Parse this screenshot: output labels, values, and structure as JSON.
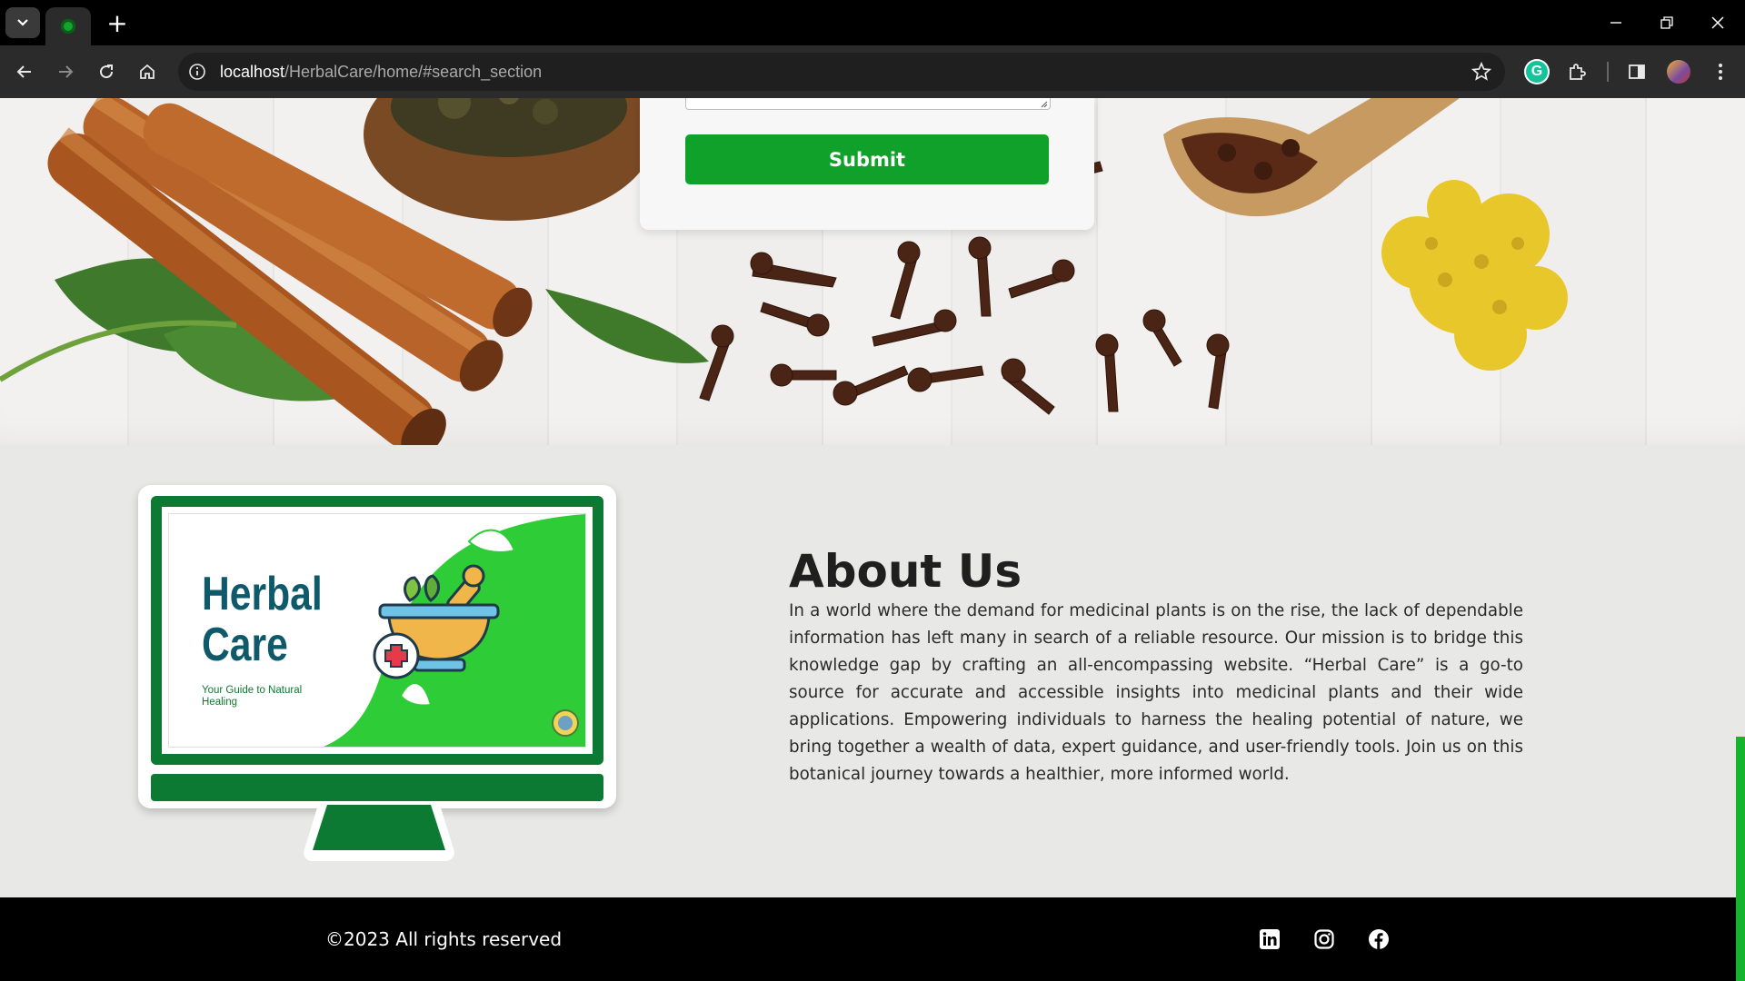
{
  "browser": {
    "url_host": "localhost",
    "url_path": "/HerbalCare/home/#search_section"
  },
  "form": {
    "submit_label": "Submit"
  },
  "about": {
    "title": "About Us",
    "body": "In a world where the demand for medicinal plants is on the rise, the lack of dependable information has left many in search of a reliable resource. Our mission is to bridge this knowledge gap by crafting an all-encompassing website. “Herbal Care” is a go-to source for accurate and accessible insights into medicinal plants and their wide applications. Empowering individuals to harness the healing potential of nature, we bring together a wealth of data, expert guidance, and user-friendly tools. Join us on this botanical journey towards a healthier, more informed world."
  },
  "brand": {
    "line1": "Herbal",
    "line2": "Care",
    "tagline": "Your Guide to Natural Healing"
  },
  "footer": {
    "copyright": "©2023 All rights reserved",
    "social": [
      "linkedin-icon",
      "instagram-icon",
      "facebook-icon"
    ]
  },
  "colors": {
    "accent_green": "#0fa12a",
    "brand_dark_green": "#0c7a33",
    "screen_green": "#2ecc36",
    "footer_bg": "#000000"
  }
}
